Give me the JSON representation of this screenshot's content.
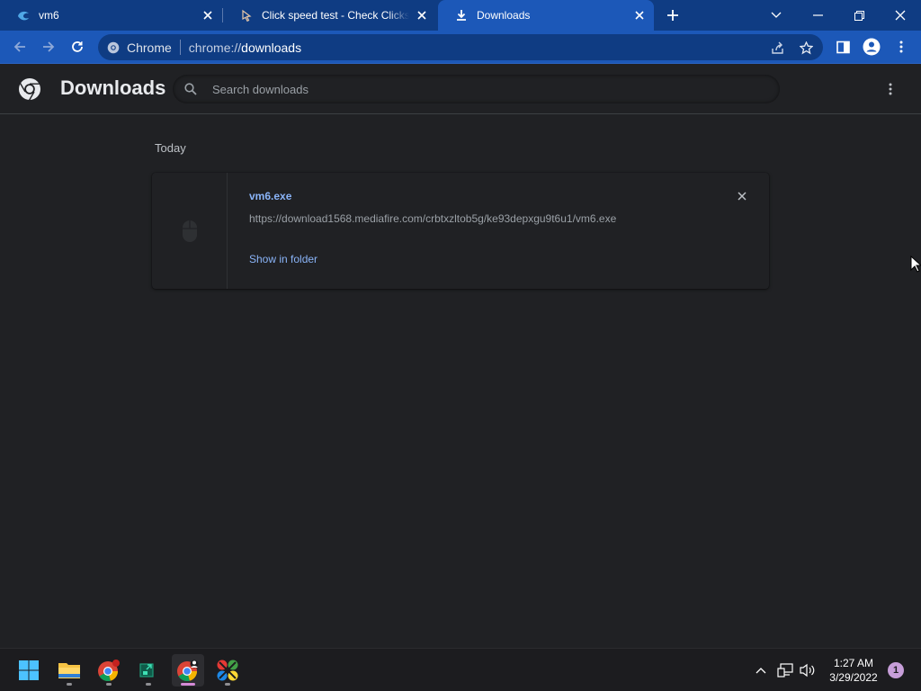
{
  "tabs": [
    {
      "title": "vm6",
      "icon": "edge-icon"
    },
    {
      "title": "Click speed test - Check Clicks per Second",
      "icon": "cursor-click-icon"
    },
    {
      "title": "Downloads",
      "icon": "download-icon",
      "active": true
    }
  ],
  "omnibox": {
    "chip_label": "Chrome",
    "url_scheme": "chrome://",
    "url_host": "downloads"
  },
  "downloads_page": {
    "title": "Downloads",
    "search_placeholder": "Search downloads",
    "date_group": "Today",
    "items": [
      {
        "file_name": "vm6.exe",
        "url": "https://download1568.mediafire.com/crbtxzltob5g/ke93depxgu9t6u1/vm6.exe",
        "action": "Show in folder"
      }
    ]
  },
  "taskbar": {
    "apps": [
      "start-icon",
      "file-explorer-icon",
      "chrome-icon",
      "terminal-app-icon",
      "chrome-active-icon",
      "paint-app-icon"
    ],
    "clock_time": "1:27 AM",
    "clock_date": "3/29/2022",
    "notification_count": "1"
  },
  "colors": {
    "tabstrip": "#0f3c83",
    "toolbar": "#1c58b8",
    "page_bg": "#202124",
    "link": "#8ab4f8"
  }
}
